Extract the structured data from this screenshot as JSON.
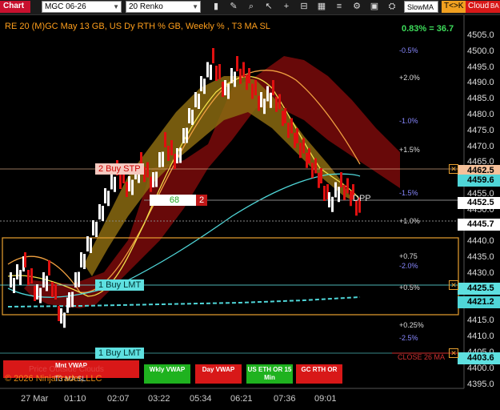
{
  "toolbar": {
    "tab_label": "Chart",
    "instrument": "MGC 06-26",
    "bar_type": "20 Renko",
    "indicator_select": "SlowMA",
    "sync_button": "T<>K",
    "cloud_button": "Cloud",
    "bracket_button": "BA",
    "icons": [
      "bar-style-icon",
      "draw-icon",
      "zoom-icon",
      "pointer-icon",
      "crosshair-icon",
      "hline-icon",
      "grid-icon",
      "lines-icon",
      "properties-icon",
      "screenshot-icon",
      "strategy-icon"
    ]
  },
  "chart": {
    "title": "RE 20  (M)GC May 13 GB, US Dy RTH % GB, Weekly % , T3 MA SL",
    "performance": "0.83% = 36.7",
    "price_axis": [
      "4505.0",
      "4500.0",
      "4495.0",
      "4490.0",
      "4485.0",
      "4480.0",
      "4475.0",
      "4470.0",
      "4465.0",
      "4460.0",
      "4455.0",
      "4450.0",
      "4445.0",
      "4440.0",
      "4435.0",
      "4430.0",
      "4425.0",
      "4420.0",
      "4415.0",
      "4410.0",
      "4405.0",
      "4400.0",
      "4395.0"
    ],
    "time_axis": [
      "27 Mar",
      "01:10",
      "02:07",
      "03:22",
      "05:34",
      "06:21",
      "07:36",
      "09:01"
    ],
    "price_flags": [
      {
        "label": "4462.5",
        "color": "#f5c09a",
        "price": 4462.5
      },
      {
        "label": "4459.6",
        "color": "#4fd6d8",
        "price": 4459.6
      },
      {
        "label": "4452.5",
        "color": "#ffffff",
        "price": 4452.5
      },
      {
        "label": "4445.7",
        "color": "#ffffff",
        "price": 4445.7
      },
      {
        "label": "4425.5",
        "color": "#5ee0e0",
        "price": 4425.5
      },
      {
        "label": "4421.2",
        "color": "#4fd6d8",
        "price": 4421.2
      },
      {
        "label": "4403.6",
        "color": "#5ee0e0",
        "price": 4403.6
      }
    ],
    "levels": [
      {
        "label": "-0.5%",
        "color": "#8888ff",
        "price": 4500.3
      },
      {
        "label": "+2.0%",
        "color": "#dddddd",
        "price": 4491.5
      },
      {
        "label": "-1.0%",
        "color": "#8888ff",
        "price": 4478.0
      },
      {
        "label": "+1.5%",
        "color": "#dddddd",
        "price": 4469.0
      },
      {
        "label": "-1.5%",
        "color": "#8888ff",
        "price": 4455.2
      },
      {
        "label": "+1.0%",
        "color": "#dddddd",
        "price": 4446.5
      },
      {
        "label": "+0.75",
        "color": "#dddddd",
        "price": 4435.2
      },
      {
        "label": "-2.0%",
        "color": "#8888ff",
        "price": 4432.3
      },
      {
        "label": "+0.5%",
        "color": "#dddddd",
        "price": 4425.5
      },
      {
        "label": "+0.25%",
        "color": "#dddddd",
        "price": 4413.7
      },
      {
        "label": "-2.5%",
        "color": "#8888ff",
        "price": 4409.5
      },
      {
        "label": "CLOSE 26 MA",
        "color": "#d03030",
        "price": 4403.6
      }
    ],
    "pdp_label": "DPP",
    "orders": {
      "stop": "2 Buy STP",
      "limit1": "1 Buy LMT",
      "limit2": "1 Buy LMT",
      "qty": "68",
      "qty_badge": "2"
    },
    "bottom_buttons": [
      {
        "label": "Mnt VWAP",
        "color": "#d81818"
      },
      {
        "label": "Wkly VWAP",
        "color": "#1fb21f"
      },
      {
        "label": "Day VWAP",
        "color": "#d81818"
      },
      {
        "label": "US ETH OR 15 Min",
        "color": "#1fb21f"
      },
      {
        "label": "GC RTH OR",
        "color": "#d81818"
      }
    ],
    "bottom_overlay_1": "Price Outside Clouds",
    "bottom_overlay_2": "T3 MA SL",
    "copyright": "© 2026 NinjaTrader, LLC",
    "colors": {
      "accent": "#ff9f1c",
      "up_bar": "#ffffff",
      "down_bar": "#e01010",
      "cloud_red": "#7a0a0a",
      "cloud_gold": "#8a6a10",
      "ma_yellow": "#f2e14a",
      "ma_orange": "#f0a040",
      "ma_cyan": "#4fd6d8"
    }
  }
}
